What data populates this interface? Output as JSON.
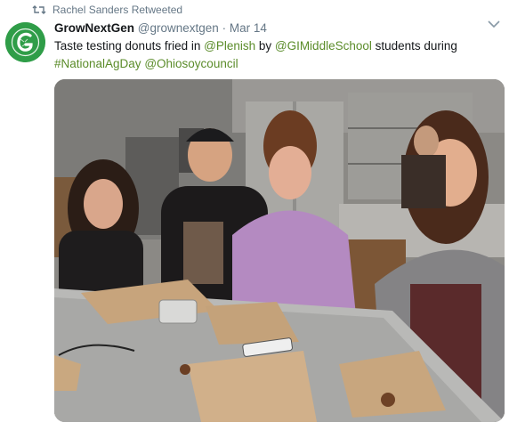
{
  "retweet": {
    "text": "Rachel Sanders Retweeted",
    "icon": "retweet-icon"
  },
  "tweet": {
    "author": {
      "display_name": "GrowNextGen",
      "handle": "@grownextgen",
      "avatar_icon": "grownextgen-logo-icon",
      "avatar_color": "#2f9d48"
    },
    "separator": "·",
    "date": "Mar 14",
    "text_segments": {
      "s1": "Taste testing donuts fried in ",
      "m1": "@Plenish",
      "s2": " by ",
      "m2": "@GIMiddleSchool",
      "s3": " students during ",
      "h1": "#NationalAgDay",
      "s4": " ",
      "m3": "@Ohiosoycouncil"
    },
    "link_color": "#5b8c2a",
    "menu_icon": "chevron-down-icon",
    "photo": {
      "alt_icon": "photo-students-tasting-donuts"
    }
  }
}
